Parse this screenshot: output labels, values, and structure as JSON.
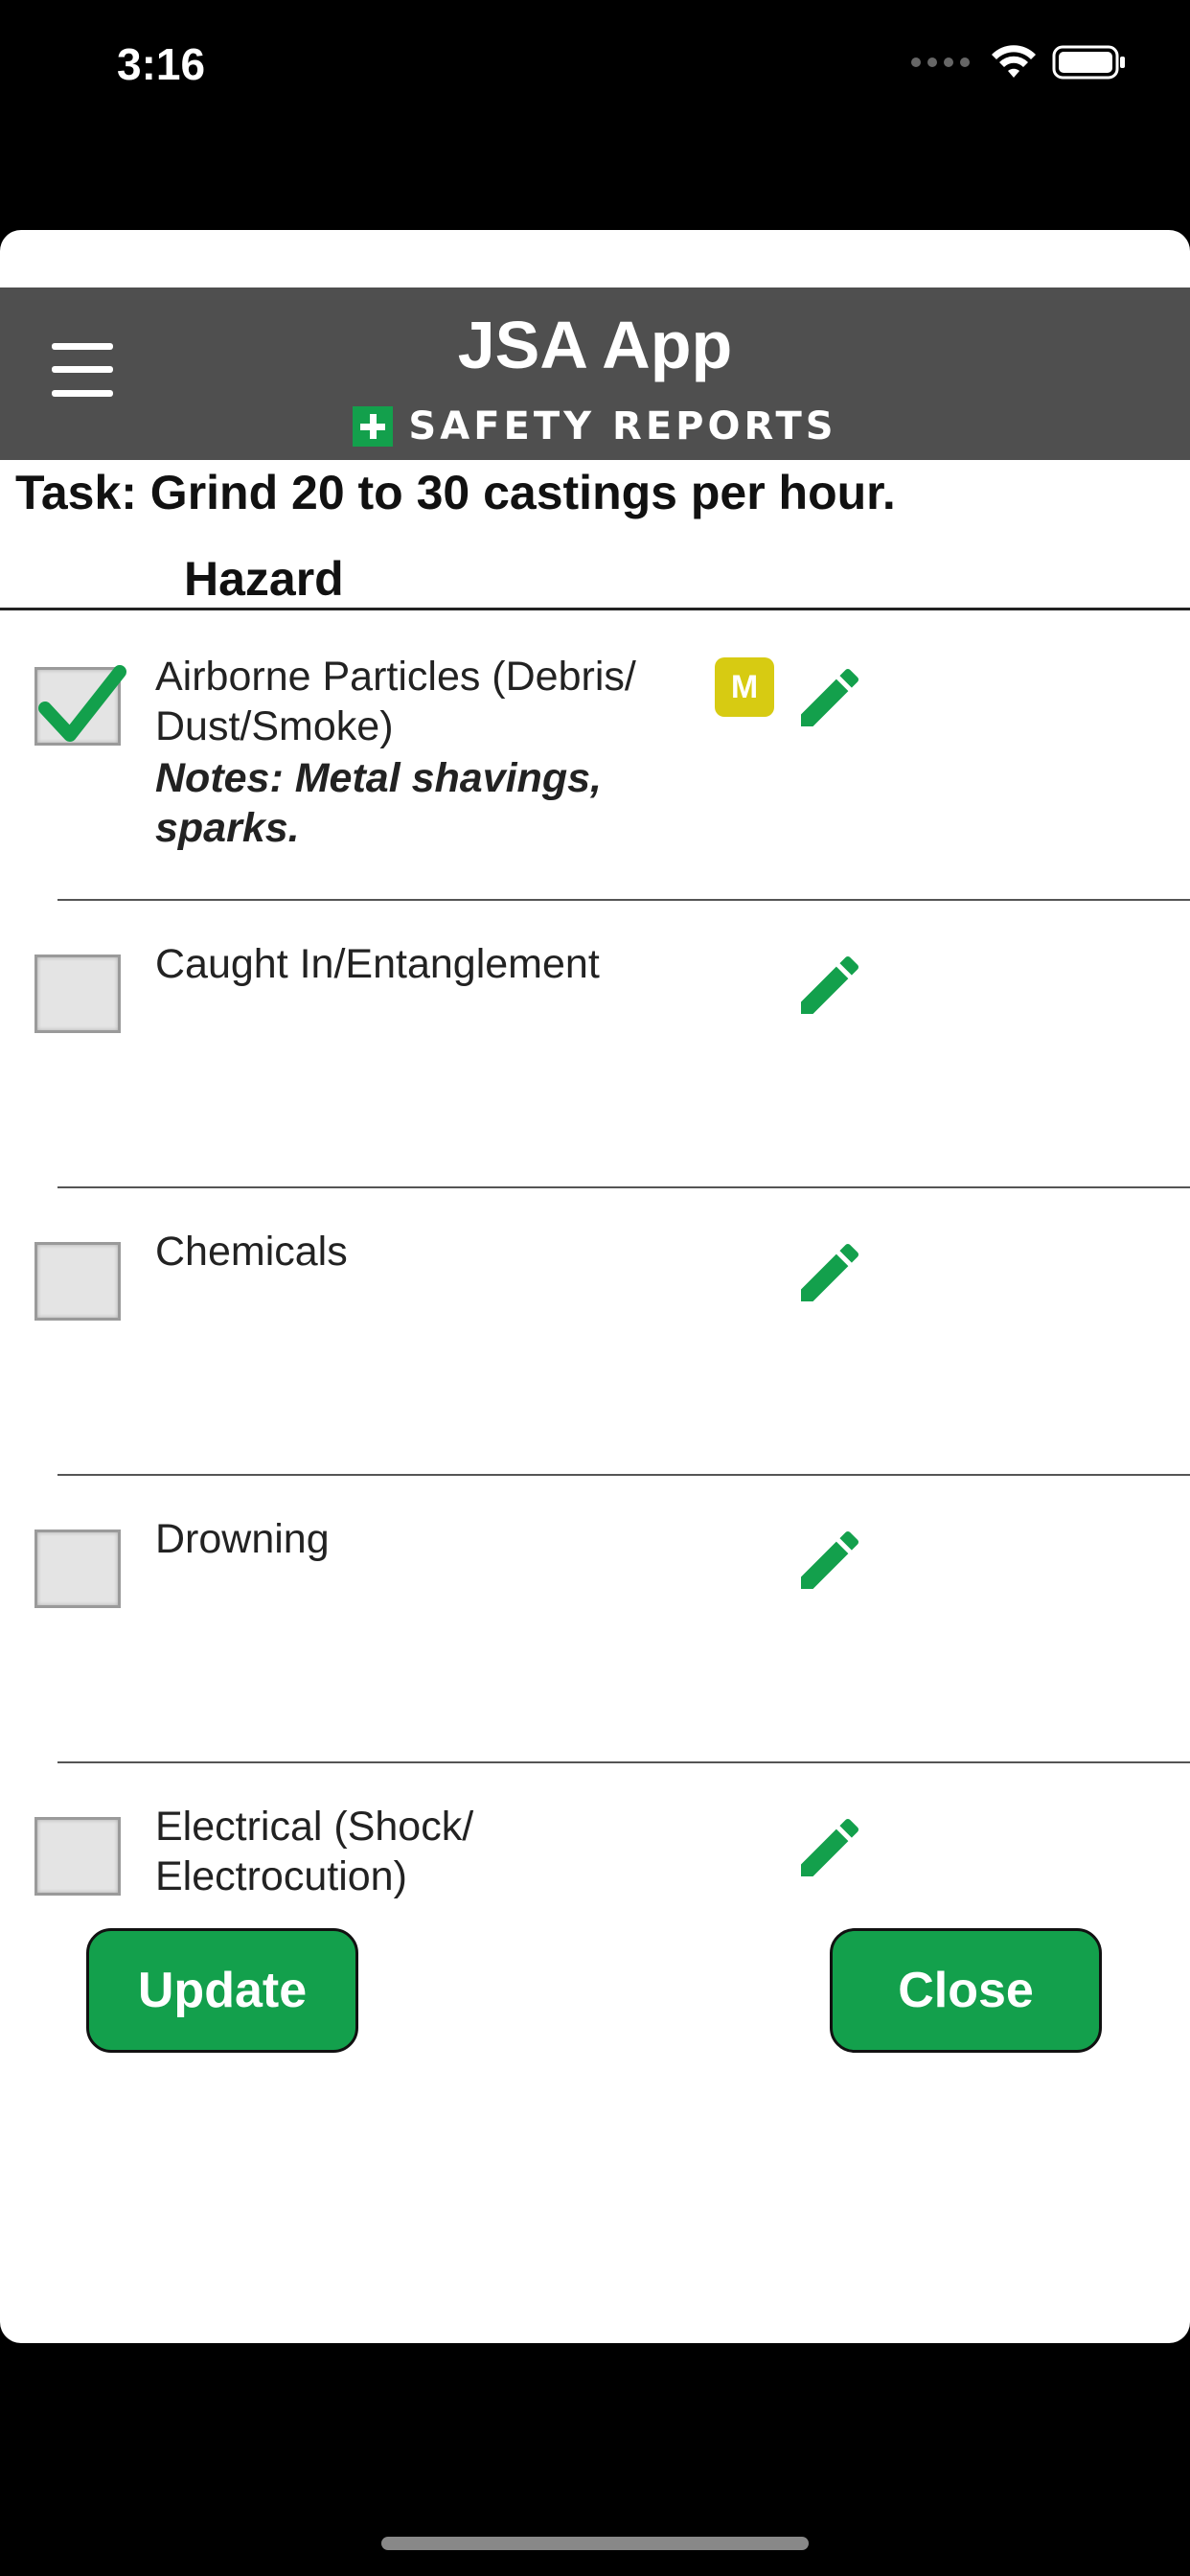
{
  "status_bar": {
    "time": "3:16",
    "icons": [
      "signal-icon",
      "wifi-icon",
      "battery-icon"
    ]
  },
  "header": {
    "title": "JSA App",
    "brand": "SAFETY REPORTS",
    "brand_color": "#13a04c",
    "background": "#4f4f4f"
  },
  "task": {
    "text": "Task: Grind 20 to 30 castings per hour."
  },
  "list": {
    "column_header": "Hazard",
    "items": [
      {
        "label": "Airborne Particles (Debris/ Dust/Smoke)",
        "notes": "Notes: Metal shavings, sparks.",
        "checked": true,
        "badge": "M"
      },
      {
        "label": "Caught In/Entanglement",
        "notes": "",
        "checked": false,
        "badge": ""
      },
      {
        "label": "Chemicals",
        "notes": "",
        "checked": false,
        "badge": ""
      },
      {
        "label": "Drowning",
        "notes": "",
        "checked": false,
        "badge": ""
      },
      {
        "label": "Electrical (Shock/ Electrocution)",
        "notes": "",
        "checked": false,
        "badge": ""
      }
    ]
  },
  "actions": {
    "update_label": "Update",
    "close_label": "Close",
    "button_color": "#13a04c"
  },
  "colors": {
    "badge": "#d7cb12",
    "edit_icon": "#13a04c"
  }
}
